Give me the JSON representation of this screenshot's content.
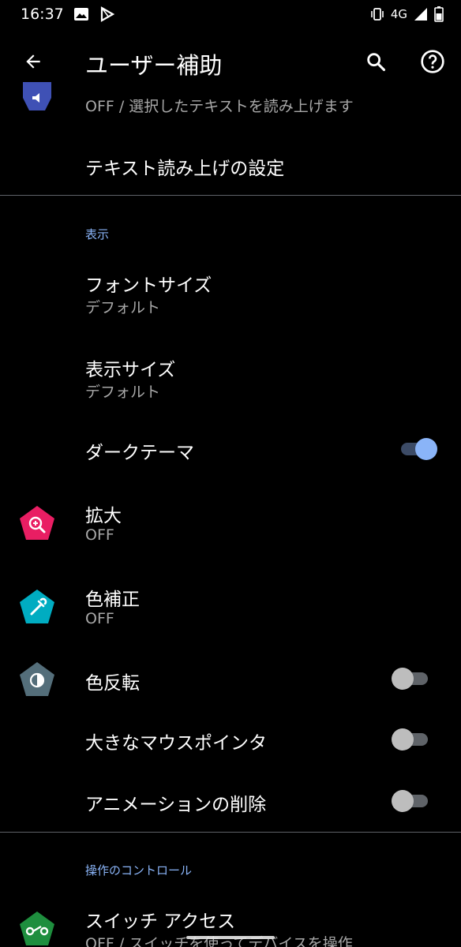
{
  "status": {
    "time": "16:37",
    "network": "4G"
  },
  "appbar": {
    "title": "ユーザー補助"
  },
  "tts_partial": {
    "secondary": "OFF / 選択したテキストを読み上げます"
  },
  "tts_settings": {
    "label": "テキスト読み上げの設定"
  },
  "display_section": {
    "header": "表示",
    "font_size": {
      "label": "フォントサイズ",
      "value": "デフォルト"
    },
    "display_size": {
      "label": "表示サイズ",
      "value": "デフォルト"
    },
    "dark_theme": {
      "label": "ダークテーマ",
      "on": true
    },
    "magnification": {
      "label": "拡大",
      "value": "OFF"
    },
    "color_correction": {
      "label": "色補正",
      "value": "OFF"
    },
    "color_inversion": {
      "label": "色反転",
      "on": false
    },
    "large_pointer": {
      "label": "大きなマウスポインタ",
      "on": false
    },
    "remove_animations": {
      "label": "アニメーションの削除",
      "on": false
    }
  },
  "interaction_section": {
    "header": "操作のコントロール",
    "switch_access": {
      "label": "スイッチ アクセス",
      "value": "OFF / スイッチを使ってデバイスを操作"
    }
  },
  "colors": {
    "accent": "#8ab4f8",
    "magnify_icon": "#e91e63",
    "color_correction_icon": "#00acc1",
    "inversion_icon": "#546e7a",
    "tts_icon": "#3f51b5",
    "switch_icon": "#1e8e3e"
  }
}
